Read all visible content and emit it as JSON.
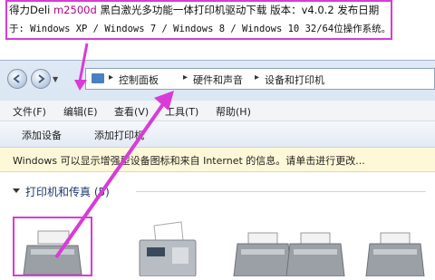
{
  "article": {
    "line1_pre": "得力Deli ",
    "line1_model": "m2500d",
    "line1_post": " 黑白激光多功能一体打印机驱动下载 版本：v4.0.2 发布日期",
    "line2": "于: Windows XP / Windows 7 / Windows 8 / Windows 10 32/64位操作系统。"
  },
  "breadcrumb": [
    "控制面板",
    "硬件和声音",
    "设备和打印机"
  ],
  "menu": [
    "文件(F)",
    "编辑(E)",
    "查看(V)",
    "工具(T)",
    "帮助(H)"
  ],
  "commands": [
    "添加设备",
    "添加打印机"
  ],
  "infobar": {
    "text": "Windows 可以显示增强型设备图标和来自 Internet 的信息。请单击进行更改..."
  },
  "group": {
    "title": "打印机和传真 (5)"
  },
  "devices": [
    {
      "type": "printer",
      "selected": true
    },
    {
      "type": "fax"
    },
    {
      "type": "printer"
    },
    {
      "type": "printer"
    },
    {
      "type": "printer"
    }
  ],
  "colors": {
    "highlight": "#d83bd8",
    "link": "#1e3a6e",
    "infobar": "#fff8d8"
  }
}
